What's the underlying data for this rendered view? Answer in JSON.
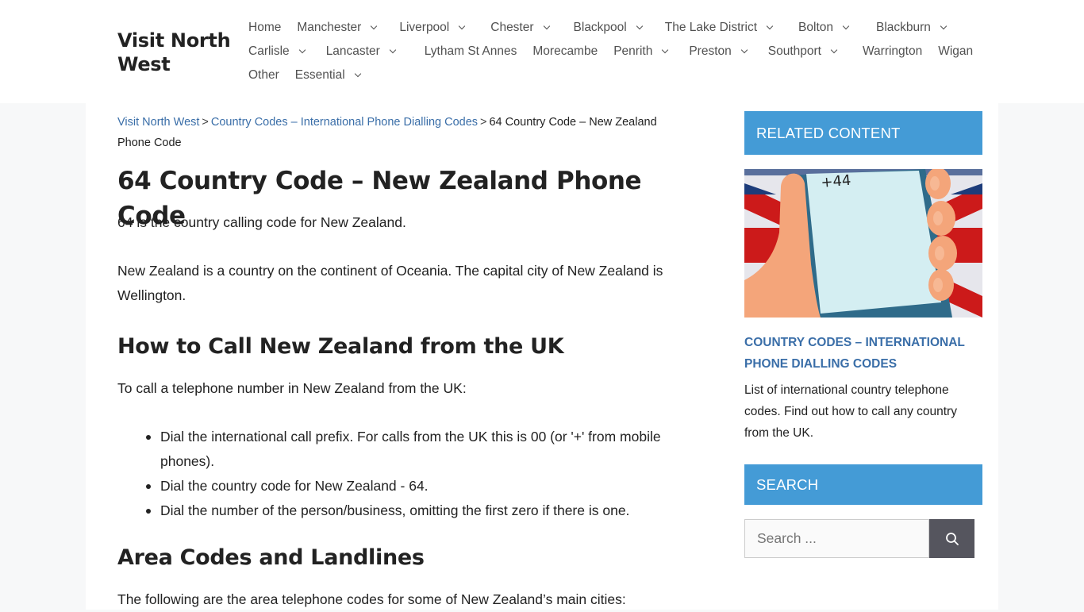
{
  "site": {
    "title": "Visit North West"
  },
  "nav": {
    "rows": [
      [
        {
          "label": "Home",
          "dropdown": false
        },
        {
          "label": "Manchester",
          "dropdown": true
        },
        {
          "label": "Liverpool",
          "dropdown": true
        },
        {
          "label": "Chester",
          "dropdown": true
        },
        {
          "label": "Blackpool",
          "dropdown": true
        },
        {
          "label": "The Lake District",
          "dropdown": true
        },
        {
          "label": "Bolton",
          "dropdown": true
        },
        {
          "label": "Blackburn",
          "dropdown": true
        }
      ],
      [
        {
          "label": "Carlisle",
          "dropdown": true
        },
        {
          "label": "Lancaster",
          "dropdown": true
        },
        {
          "label": "Lytham St Annes",
          "dropdown": false
        },
        {
          "label": "Morecambe",
          "dropdown": false
        },
        {
          "label": "Penrith",
          "dropdown": true
        },
        {
          "label": "Preston",
          "dropdown": true
        },
        {
          "label": "Southport",
          "dropdown": true
        },
        {
          "label": "Warrington",
          "dropdown": false
        },
        {
          "label": "Wigan",
          "dropdown": false
        }
      ],
      [
        {
          "label": "Other",
          "dropdown": false
        },
        {
          "label": "Essential",
          "dropdown": true
        }
      ]
    ]
  },
  "breadcrumb": {
    "home": "Visit North West",
    "parent": "Country Codes – International Phone Dialling Codes",
    "current": "64 Country Code – New Zealand Phone Code",
    "separator": ">"
  },
  "article": {
    "title": "64 Country Code – New Zealand Phone Code",
    "intro": "64 is the country calling code for New Zealand.",
    "about": "New Zealand is a country on the continent of Oceania. The capital city of New Zealand is Wellington.",
    "how_to_heading": "How to Call New Zealand from the UK",
    "how_to_intro": "To call a telephone number in New Zealand from the UK:",
    "steps": [
      "Dial the international call prefix. For calls from the UK this is 00 (or '+' from mobile phones).",
      "Dial the country code for New Zealand - 64.",
      "Dial the number of the person/business, omitting the first zero if there is one."
    ],
    "area_heading": "Area Codes and Landlines",
    "area_intro": "The following are the area telephone codes for some of New Zealand’s main cities:"
  },
  "sidebar": {
    "related_title": "RELATED CONTENT",
    "related_image_text": "+44",
    "related_link": "Country Codes – International Phone Dialling Codes",
    "related_desc": "List of international country telephone codes. Find out how to call any country from the UK.",
    "search_title": "SEARCH",
    "search_placeholder": "Search ...",
    "search_value": ""
  },
  "colors": {
    "accent": "#449bd6",
    "link": "#3a6ea8",
    "search_button": "#55555e"
  }
}
